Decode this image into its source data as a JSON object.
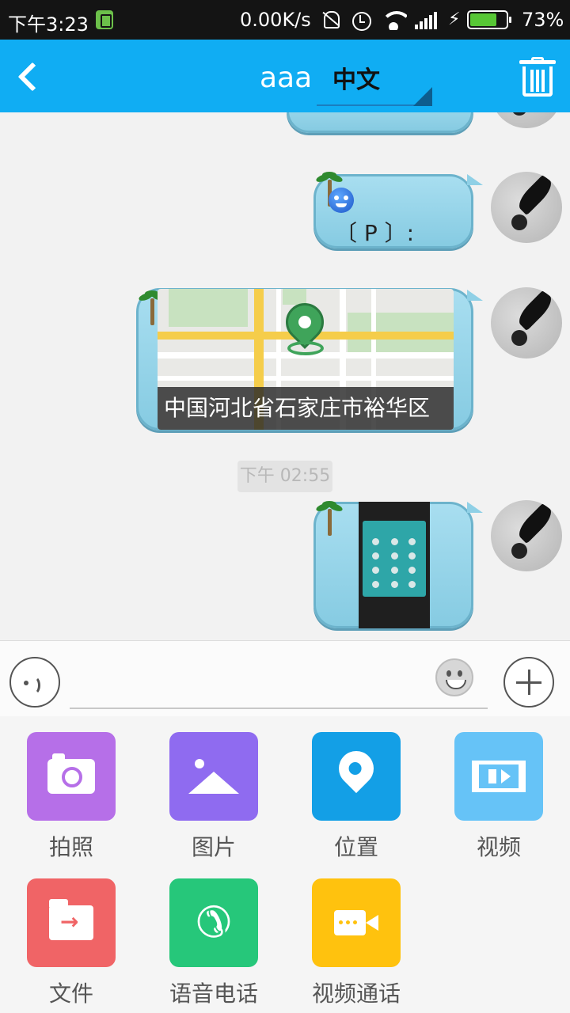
{
  "status_bar": {
    "time": "下午3:23",
    "network_speed": "0.00K/s",
    "battery_percent": "73%",
    "battery_level": 0.73
  },
  "header": {
    "title": "aaa",
    "language": "中文"
  },
  "messages": {
    "voice_text": "〔 P 〕:",
    "location_address": "中国河北省石家庄市裕华区",
    "timestamp": "下午 02:55"
  },
  "input": {
    "placeholder": ""
  },
  "attachments": [
    {
      "label": "拍照",
      "icon": "camera-icon",
      "color": "#b66fe8"
    },
    {
      "label": "图片",
      "icon": "image-icon",
      "color": "#8f6bf0"
    },
    {
      "label": "位置",
      "icon": "location-pin-icon",
      "color": "#139fe6"
    },
    {
      "label": "视频",
      "icon": "film-icon",
      "color": "#66c3f7"
    },
    {
      "label": "文件",
      "icon": "folder-icon",
      "color": "#f06466"
    },
    {
      "label": "语音电话",
      "icon": "phone-icon",
      "color": "#26c77a"
    },
    {
      "label": "视频通话",
      "icon": "video-call-icon",
      "color": "#ffc20e"
    }
  ],
  "colors": {
    "header": "#10adf3",
    "bubble": "#8fd0e6"
  }
}
